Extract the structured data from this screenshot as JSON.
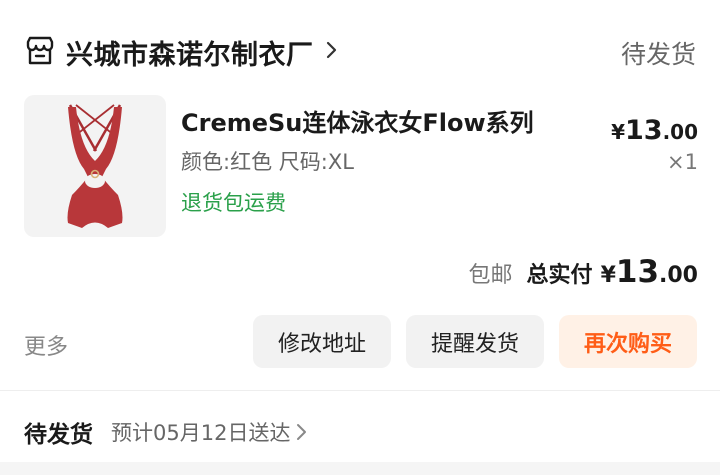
{
  "shop": {
    "name": "兴城市森诺尔制衣厂",
    "icon": "store-icon",
    "status": "待发货"
  },
  "product": {
    "title": "CremeSu连体泳衣女Flow系列",
    "spec": "颜色:红色 尺码:XL",
    "return_tag": "退货包运费",
    "price_symbol": "¥",
    "price_int": "13",
    "price_dec": ".00",
    "qty": "×1",
    "swimsuit_color": "#b8373a"
  },
  "total": {
    "shipping": "包邮",
    "label": "总实付",
    "symbol": "¥",
    "int": "13",
    "dec": ".00"
  },
  "actions": {
    "more": "更多",
    "edit_address": "修改地址",
    "remind": "提醒发货",
    "rebuy": "再次购买",
    "rebuy_color": "#ff5d17"
  },
  "footer": {
    "status": "待发货",
    "eta": "预计05月12日送达"
  }
}
